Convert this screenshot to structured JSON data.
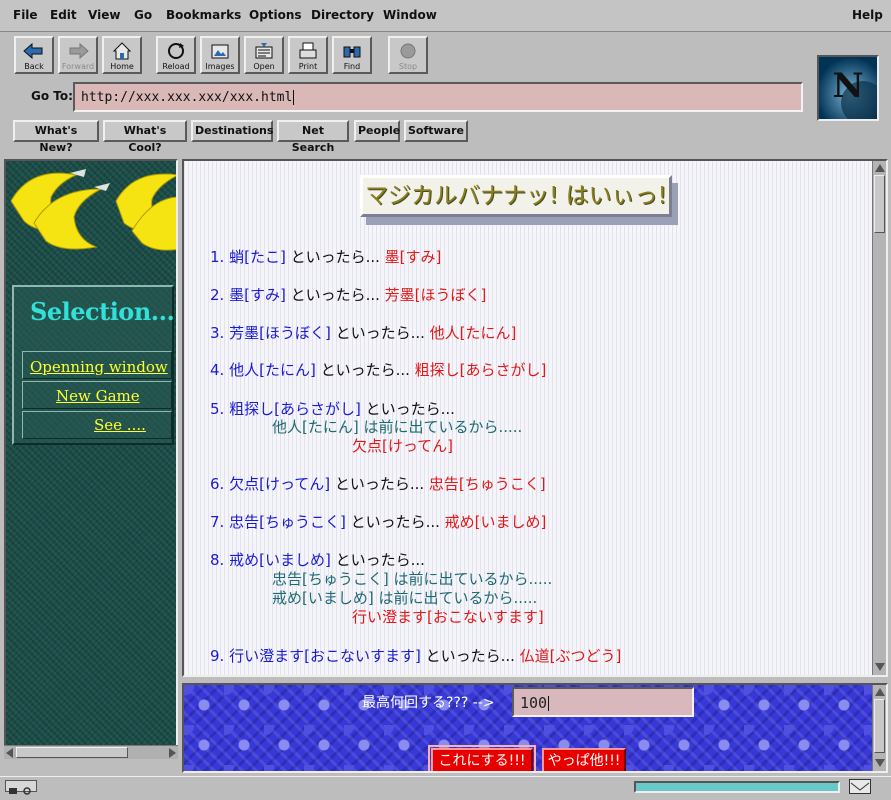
{
  "menubar": {
    "items": [
      "File",
      "Edit",
      "View",
      "Go",
      "Bookmarks",
      "Options",
      "Directory",
      "Window"
    ],
    "help": "Help"
  },
  "toolbar": {
    "buttons": [
      {
        "label": "Back",
        "icon": "back-arrow-icon",
        "enabled": true
      },
      {
        "label": "Forward",
        "icon": "forward-arrow-icon",
        "enabled": false
      },
      {
        "label": "Home",
        "icon": "home-icon",
        "enabled": true
      },
      {
        "label": "Reload",
        "icon": "reload-icon",
        "enabled": true
      },
      {
        "label": "Images",
        "icon": "images-icon",
        "enabled": true
      },
      {
        "label": "Open",
        "icon": "open-icon",
        "enabled": true
      },
      {
        "label": "Print",
        "icon": "print-icon",
        "enabled": true
      },
      {
        "label": "Find",
        "icon": "find-icon",
        "enabled": true
      },
      {
        "label": "Stop",
        "icon": "stop-icon",
        "enabled": false
      }
    ]
  },
  "location": {
    "label": "Go To:",
    "url": "http://xxx.xxx.xxx/xxx.html"
  },
  "directory_buttons": [
    "What's New?",
    "What's Cool?",
    "Destinations",
    "Net Search",
    "People",
    "Software"
  ],
  "logo": {
    "letter": "N"
  },
  "sidebar": {
    "title": "Selection....",
    "links": [
      "Openning window",
      "New Game",
      "See ...."
    ]
  },
  "main": {
    "title": "マジカルバナナッ! はいぃっ!",
    "items": [
      {
        "num": "1.",
        "word": "蛸[たこ]",
        "say": " といったら...",
        "next": " 墨[すみ]"
      },
      {
        "num": "2.",
        "word": "墨[すみ]",
        "say": " といったら...",
        "next": " 芳墨[ほうぼく]"
      },
      {
        "num": "3.",
        "word": "芳墨[ほうぼく]",
        "say": " といったら...",
        "next": " 他人[たにん]"
      },
      {
        "num": "4.",
        "word": "他人[たにん]",
        "say": " といったら...",
        "next": " 粗探し[あらさがし]"
      },
      {
        "num": "5.",
        "word": "粗探し[あらさがし]",
        "say": " といったら...",
        "next": ""
      },
      {
        "num": "6.",
        "word": "欠点[けってん]",
        "say": " といったら...",
        "next": " 忠告[ちゅうこく]"
      },
      {
        "num": "7.",
        "word": "忠告[ちゅうこく]",
        "say": " といったら...",
        "next": " 戒め[いましめ]"
      },
      {
        "num": "8.",
        "word": "戒め[いましめ]",
        "say": " といったら...",
        "next": ""
      },
      {
        "num": "9.",
        "word": "行い澄ます[おこないすます]",
        "say": " といったら...",
        "next": " 仏道[ぶつどう]"
      }
    ],
    "item5_dup": {
      "word": "他人[たにん]",
      "note": " は前に出ているから.....",
      "answer": "欠点[けってん]"
    },
    "item8_dup1": {
      "word": "忠告[ちゅうこく]",
      "note": " は前に出ているから....."
    },
    "item8_dup2": {
      "word": "戒め[いましめ]",
      "note": " は前に出ているから.....",
      "answer": "行い澄ます[おこないすます]"
    }
  },
  "form": {
    "label": "最高何回する??? -->",
    "value": "100",
    "submit": "これにする!!!",
    "other": "やっぱ他!!!"
  },
  "status": {
    "progress": 1.0
  },
  "colors": {
    "accent_red": "#e01818",
    "link_blue": "#1a1ad0",
    "sidebar_teal": "#1e4f4a",
    "link_yellow": "#ffff33",
    "title_cyan": "#33e0d8",
    "form_blue": "#3838d8"
  }
}
